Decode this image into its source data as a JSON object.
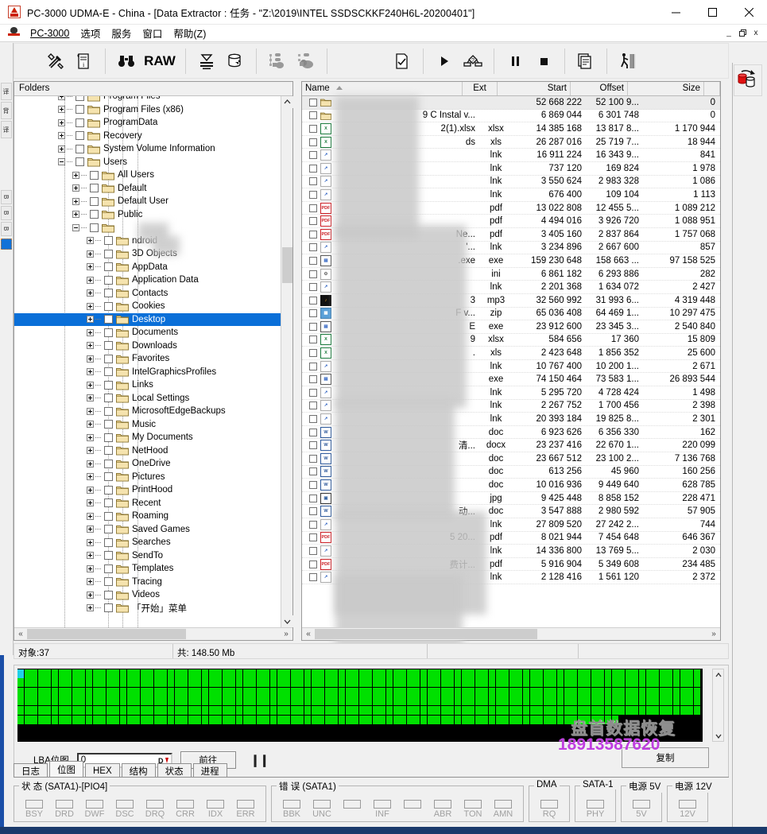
{
  "window": {
    "title": "PC-3000 UDMA-E - China - [Data Extractor : 任务 - \"Z:\\2019\\INTEL SSDSCKKF240H6L-20200401\"]",
    "minimize": "–",
    "maximize": "□",
    "close": "✕"
  },
  "menubar": {
    "app_label": "PC-3000",
    "items": [
      "选项",
      "服务",
      "窗口",
      "帮助(Z)"
    ],
    "mdi": [
      "_",
      "🗗",
      "x"
    ]
  },
  "toolbar": {
    "raw_label": "RAW",
    "buttons": [
      "tools-icon",
      "info-document-icon",
      "binoculars-icon",
      "raw-label",
      "filter-icon",
      "disk-export-icon",
      "map-structure-icon",
      "map-structure-2-icon",
      "new-task-icon",
      "play-icon",
      "flow-diagram-icon",
      "pause-icon",
      "stop-icon",
      "copy-pages-icon",
      "walk-icon"
    ]
  },
  "left_rail": {
    "tabs": [
      "译",
      "背",
      "译",
      "B",
      "B",
      "B"
    ]
  },
  "folders": {
    "header": "Folders",
    "items": [
      {
        "label": "Program Files",
        "depth": 1,
        "expander": "plus",
        "partial": true
      },
      {
        "label": "Program Files (x86)",
        "depth": 1,
        "expander": "plus"
      },
      {
        "label": "ProgramData",
        "depth": 1,
        "expander": "plus"
      },
      {
        "label": "Recovery",
        "depth": 1,
        "expander": "plus"
      },
      {
        "label": "System Volume Information",
        "depth": 1,
        "expander": "plus"
      },
      {
        "label": "Users",
        "depth": 1,
        "expander": "minus"
      },
      {
        "label": "All Users",
        "depth": 2,
        "expander": "plus"
      },
      {
        "label": "Default",
        "depth": 2,
        "expander": "plus"
      },
      {
        "label": "Default User",
        "depth": 2,
        "expander": "plus"
      },
      {
        "label": "Public",
        "depth": 2,
        "expander": "plus"
      },
      {
        "label": "",
        "depth": 2,
        "expander": "minus",
        "blurred": true
      },
      {
        "label": "ndroid",
        "depth": 3,
        "expander": "plus",
        "blurred_prefix": true
      },
      {
        "label": "3D Objects",
        "depth": 3,
        "expander": "plus"
      },
      {
        "label": "AppData",
        "depth": 3,
        "expander": "plus"
      },
      {
        "label": "Application Data",
        "depth": 3,
        "expander": "plus"
      },
      {
        "label": "Contacts",
        "depth": 3,
        "expander": "plus"
      },
      {
        "label": "Cookies",
        "depth": 3,
        "expander": "plus"
      },
      {
        "label": "Desktop",
        "depth": 3,
        "expander": "plus",
        "selected": true
      },
      {
        "label": "Documents",
        "depth": 3,
        "expander": "plus"
      },
      {
        "label": "Downloads",
        "depth": 3,
        "expander": "plus"
      },
      {
        "label": "Favorites",
        "depth": 3,
        "expander": "plus"
      },
      {
        "label": "IntelGraphicsProfiles",
        "depth": 3,
        "expander": "plus"
      },
      {
        "label": "Links",
        "depth": 3,
        "expander": "plus"
      },
      {
        "label": "Local Settings",
        "depth": 3,
        "expander": "plus"
      },
      {
        "label": "MicrosoftEdgeBackups",
        "depth": 3,
        "expander": "plus"
      },
      {
        "label": "Music",
        "depth": 3,
        "expander": "plus"
      },
      {
        "label": "My Documents",
        "depth": 3,
        "expander": "plus"
      },
      {
        "label": "NetHood",
        "depth": 3,
        "expander": "plus"
      },
      {
        "label": "OneDrive",
        "depth": 3,
        "expander": "plus"
      },
      {
        "label": "Pictures",
        "depth": 3,
        "expander": "plus"
      },
      {
        "label": "PrintHood",
        "depth": 3,
        "expander": "plus"
      },
      {
        "label": "Recent",
        "depth": 3,
        "expander": "plus"
      },
      {
        "label": "Roaming",
        "depth": 3,
        "expander": "plus"
      },
      {
        "label": "Saved Games",
        "depth": 3,
        "expander": "plus"
      },
      {
        "label": "Searches",
        "depth": 3,
        "expander": "plus"
      },
      {
        "label": "SendTo",
        "depth": 3,
        "expander": "plus"
      },
      {
        "label": "Templates",
        "depth": 3,
        "expander": "plus"
      },
      {
        "label": "Tracing",
        "depth": 3,
        "expander": "plus"
      },
      {
        "label": "Videos",
        "depth": 3,
        "expander": "plus"
      },
      {
        "label": "「开始」菜单",
        "depth": 3,
        "expander": "plus"
      }
    ],
    "scroll_left": "«",
    "scroll_right": "»"
  },
  "filelist": {
    "columns": [
      {
        "key": "name",
        "label": "Name",
        "sorted": true
      },
      {
        "key": "ext",
        "label": "Ext"
      },
      {
        "key": "start",
        "label": "Start"
      },
      {
        "key": "offset",
        "label": "Offset"
      },
      {
        "key": "size",
        "label": "Size"
      }
    ],
    "rows": [
      {
        "icon": "folder",
        "name": "",
        "ext": "",
        "start": "52 668 222",
        "offset": "52 100 9...",
        "size": "0",
        "blur": true
      },
      {
        "icon": "folder",
        "name": "9 C   Instal v...",
        "ext": "",
        "start": "6 869 044",
        "offset": "6 301 748",
        "size": "0",
        "blur": true
      },
      {
        "icon": "xls",
        "name": "2(1).xlsx",
        "ext": "xlsx",
        "start": "14 385 168",
        "offset": "13 817 8...",
        "size": "1 170 944",
        "blur": true
      },
      {
        "icon": "xls",
        "name": "ds",
        "ext": "xls",
        "start": "26 287 016",
        "offset": "25 719 7...",
        "size": "18 944",
        "blur": true
      },
      {
        "icon": "lnk",
        "name": "",
        "ext": "lnk",
        "start": "16 911 224",
        "offset": "16 343 9...",
        "size": "841",
        "blur": true
      },
      {
        "icon": "lnk",
        "name": "",
        "ext": "lnk",
        "start": "737 120",
        "offset": "169 824",
        "size": "1 978",
        "blur": true
      },
      {
        "icon": "lnk",
        "name": "",
        "ext": "lnk",
        "start": "3 550 624",
        "offset": "2 983 328",
        "size": "1 086",
        "blur": true
      },
      {
        "icon": "lnk",
        "name": "",
        "ext": "lnk",
        "start": "676 400",
        "offset": "109 104",
        "size": "1 113",
        "blur": true
      },
      {
        "icon": "pdf",
        "name": "",
        "ext": "pdf",
        "start": "13 022 808",
        "offset": "12 455 5...",
        "size": "1 089 212",
        "blur": true
      },
      {
        "icon": "pdf",
        "name": "",
        "ext": "pdf",
        "start": "4 494 016",
        "offset": "3 926 720",
        "size": "1 088 951",
        "blur": true
      },
      {
        "icon": "pdf",
        "name": "Ne...",
        "ext": "pdf",
        "start": "3 405 160",
        "offset": "2 837 864",
        "size": "1 757 068",
        "blur": true
      },
      {
        "icon": "lnk",
        "name": "'...",
        "ext": "lnk",
        "start": "3 234 896",
        "offset": "2 667 600",
        "size": "857",
        "blur": true
      },
      {
        "icon": "exe",
        "name": ".exe",
        "ext": "exe",
        "start": "159 230 648",
        "offset": "158 663 ...",
        "size": "97 158 525",
        "blur": true
      },
      {
        "icon": "ini",
        "name": "",
        "ext": "ini",
        "start": "6 861 182",
        "offset": "6 293 886",
        "size": "282",
        "blur": true
      },
      {
        "icon": "lnk",
        "name": "",
        "ext": "lnk",
        "start": "2 201 368",
        "offset": "1 634 072",
        "size": "2 427",
        "blur": true
      },
      {
        "icon": "mp3",
        "name": "3",
        "ext": "mp3",
        "start": "32 560 992",
        "offset": "31 993 6...",
        "size": "4 319 448",
        "blur": true
      },
      {
        "icon": "zip",
        "name": "F      v...",
        "ext": "zip",
        "start": "65 036 408",
        "offset": "64 469 1...",
        "size": "10 297 475",
        "blur": true
      },
      {
        "icon": "exe",
        "name": "E",
        "ext": "exe",
        "start": "23 912 600",
        "offset": "23 345 3...",
        "size": "2 540 840",
        "blur": true
      },
      {
        "icon": "xls",
        "name": "9",
        "ext": "xlsx",
        "start": "584 656",
        "offset": "17 360",
        "size": "15 809",
        "blur": true
      },
      {
        "icon": "xls",
        "name": ".",
        "ext": "xls",
        "start": "2 423 648",
        "offset": "1 856 352",
        "size": "25 600",
        "blur": true
      },
      {
        "icon": "lnk",
        "name": "",
        "ext": "lnk",
        "start": "10 767 400",
        "offset": "10 200 1...",
        "size": "2 671",
        "blur": true
      },
      {
        "icon": "exe",
        "name": "",
        "ext": "exe",
        "start": "74 150 464",
        "offset": "73 583 1...",
        "size": "26 893 544",
        "blur": true
      },
      {
        "icon": "lnk",
        "name": "",
        "ext": "lnk",
        "start": "5 295 720",
        "offset": "4 728 424",
        "size": "1 498",
        "blur": true
      },
      {
        "icon": "lnk",
        "name": "",
        "ext": "lnk",
        "start": "2 267 752",
        "offset": "1 700 456",
        "size": "2 398",
        "blur": true
      },
      {
        "icon": "lnk",
        "name": "",
        "ext": "lnk",
        "start": "20 393 184",
        "offset": "19 825 8...",
        "size": "2 301",
        "blur": true
      },
      {
        "icon": "doc",
        "name": "",
        "ext": "doc",
        "start": "6 923 626",
        "offset": "6 356 330",
        "size": "162",
        "blur": true
      },
      {
        "icon": "doc",
        "name": "清...",
        "ext": "docx",
        "start": "23 237 416",
        "offset": "22 670 1...",
        "size": "220 099",
        "blur": true
      },
      {
        "icon": "doc",
        "name": "",
        "ext": "doc",
        "start": "23 667 512",
        "offset": "23 100 2...",
        "size": "7 136 768",
        "blur": true
      },
      {
        "icon": "doc",
        "name": "",
        "ext": "doc",
        "start": "613 256",
        "offset": "45 960",
        "size": "160 256",
        "blur": true
      },
      {
        "icon": "doc",
        "name": "",
        "ext": "doc",
        "start": "10 016 936",
        "offset": "9 449 640",
        "size": "628 785",
        "blur": true
      },
      {
        "icon": "jpg",
        "name": "",
        "ext": "jpg",
        "start": "9 425 448",
        "offset": "8 858 152",
        "size": "228 471",
        "blur": true
      },
      {
        "icon": "doc",
        "name": "动...",
        "ext": "doc",
        "start": "3 547 888",
        "offset": "2 980 592",
        "size": "57 905",
        "blur": true
      },
      {
        "icon": "lnk",
        "name": "",
        "ext": "lnk",
        "start": "27 809 520",
        "offset": "27 242 2...",
        "size": "744",
        "blur": true
      },
      {
        "icon": "pdf",
        "name": "5 20...",
        "ext": "pdf",
        "start": "8 021 944",
        "offset": "7 454 648",
        "size": "646 367",
        "blur": true
      },
      {
        "icon": "lnk",
        "name": "",
        "ext": "lnk",
        "start": "14 336 800",
        "offset": "13 769 5...",
        "size": "2 030",
        "blur": true
      },
      {
        "icon": "pdf",
        "name": "费计...",
        "ext": "pdf",
        "start": "5 916 904",
        "offset": "5 349 608",
        "size": "234 485",
        "blur": true
      },
      {
        "icon": "lnk",
        "name": "",
        "ext": "lnk",
        "start": "2 128 416",
        "offset": "1 561 120",
        "size": "2 372",
        "blur": true
      }
    ],
    "scroll_left": "«",
    "scroll_right": "»"
  },
  "statusbar": {
    "objects": "对象:37",
    "total": "共:  148.50 Mb",
    "cell3": "",
    "cell4": ""
  },
  "bitmap": {
    "lba_label": "LBA位图",
    "lba_value": "0",
    "lba_placeholder": "0",
    "spinner": "D",
    "go_button": "前往",
    "pause_button": "❙❙",
    "copy_button": "复制",
    "cell_color": "#00e000",
    "first_cell_color": "#20d0e8",
    "rows": 6,
    "cols": 98
  },
  "watermark": {
    "text": "盘首数据恢复",
    "phone": "18913587620"
  },
  "tabs": {
    "items": [
      "日志",
      "位图",
      "HEX",
      "结构",
      "状态",
      "进程"
    ],
    "active": "位图"
  },
  "indicators": [
    {
      "title": "状 态 (SATA1)-[PIO4]",
      "leds": [
        "BSY",
        "DRD",
        "DWF",
        "DSC",
        "DRQ",
        "CRR",
        "IDX",
        "ERR"
      ]
    },
    {
      "title": "错 误 (SATA1)",
      "leds": [
        "BBK",
        "UNC",
        "",
        "INF",
        "",
        "ABR",
        "TON",
        "AMN"
      ]
    },
    {
      "title": "DMA",
      "leds": [
        "RQ"
      ]
    },
    {
      "title": "SATA-1",
      "leds": [
        "PHY"
      ]
    },
    {
      "title": "电源 5V",
      "leds": [
        "5V"
      ]
    },
    {
      "title": "电源 12V",
      "leds": [
        "12V"
      ]
    }
  ],
  "colors": {
    "accent_blue": "#1b4fa8",
    "selection_blue": "#0a6fd8",
    "grid_green": "#00e000",
    "watermark_purple": "#c03fe0",
    "titlebar_bg": "#ffffff"
  }
}
